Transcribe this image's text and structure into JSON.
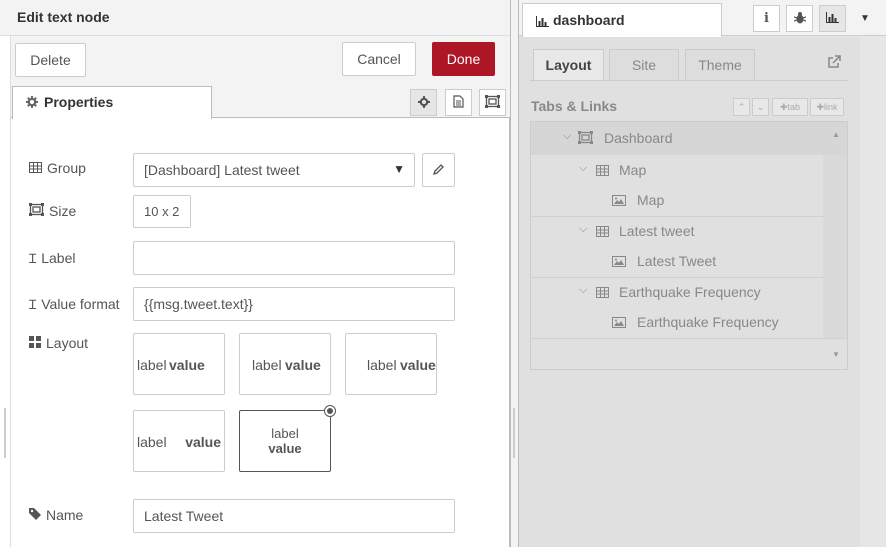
{
  "tray": {
    "title": "Edit text node",
    "delete_label": "Delete",
    "cancel_label": "Cancel",
    "done_label": "Done",
    "tab_properties": "Properties"
  },
  "form": {
    "group_label": "Group",
    "group_value": "[Dashboard] Latest tweet",
    "size_label": "Size",
    "size_value": "10 x 2",
    "label_label": "Label",
    "label_value": "",
    "value_format_label": "Value format",
    "value_format_value": "{{msg.tweet.text}}",
    "layout_label": "Layout",
    "layout_options": [
      {
        "label": "label",
        "value": "value"
      },
      {
        "label": "label",
        "value": "value"
      },
      {
        "label": "label",
        "value": "value"
      },
      {
        "label": "label",
        "value": "value"
      },
      {
        "label": "label",
        "value": "value"
      }
    ],
    "layout_selected": 4,
    "name_label": "Name",
    "name_value": "Latest Tweet"
  },
  "sidebar": {
    "tab_label": "dashboard",
    "info_icon_glyph": "i",
    "subtabs": [
      "Layout",
      "Site",
      "Theme"
    ],
    "active_subtab": "Layout",
    "tabs_links_label": "Tabs & Links",
    "tab_button": "tab",
    "link_button": "link",
    "tree": [
      {
        "label": "Dashboard",
        "type": "tab"
      },
      {
        "label": "Map",
        "type": "group"
      },
      {
        "label": "Map",
        "type": "widget"
      },
      {
        "label": "Latest tweet",
        "type": "group"
      },
      {
        "label": "Latest Tweet",
        "type": "widget"
      },
      {
        "label": "Earthquake Frequency",
        "type": "group"
      },
      {
        "label": "Earthquake Frequency",
        "type": "widget"
      }
    ]
  },
  "colors": {
    "done_button": "#ad1625"
  }
}
